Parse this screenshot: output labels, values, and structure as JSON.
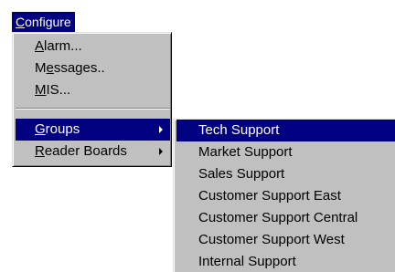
{
  "menubar": {
    "title_first": "C",
    "title_rest": "onfigure"
  },
  "dropdown": {
    "items": [
      {
        "first": "A",
        "rest": "larm..."
      },
      {
        "pre": "M",
        "mn": "e",
        "post": "ssages.."
      },
      {
        "first": "M",
        "rest": "IS..."
      },
      {
        "first": "G",
        "rest": "roups"
      },
      {
        "first": "R",
        "rest": "eader Boards"
      }
    ]
  },
  "submenu": {
    "items": [
      "Tech Support",
      "Market Support",
      "Sales Support",
      "Customer Support East",
      "Customer Support Central",
      "Customer Support West",
      "Internal Support"
    ]
  },
  "colors": {
    "highlight": "#000080",
    "menu_bg": "#c0c0c0"
  }
}
